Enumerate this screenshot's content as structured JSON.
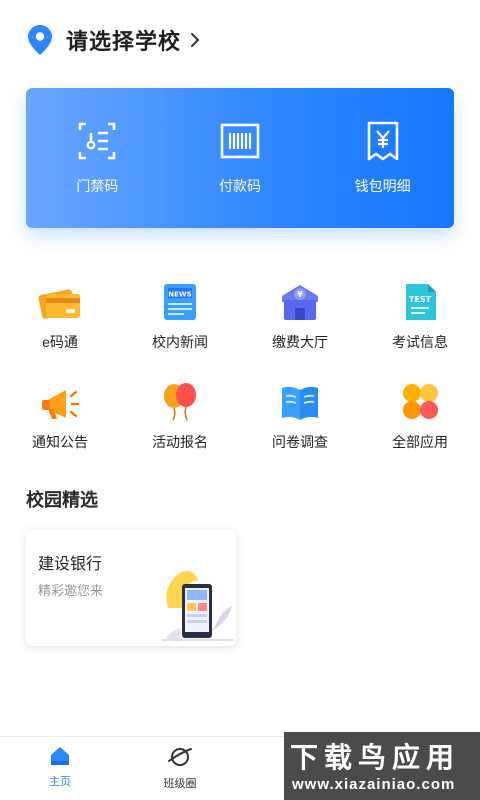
{
  "header": {
    "title": "请选择学校"
  },
  "card": {
    "items": [
      {
        "label": "门禁码",
        "icon": "access-card-icon"
      },
      {
        "label": "付款码",
        "icon": "barcode-icon"
      },
      {
        "label": "钱包明细",
        "icon": "yuan-receipt-icon"
      }
    ]
  },
  "grid": {
    "items": [
      {
        "label": "e码通",
        "icon": "card-wallet-icon"
      },
      {
        "label": "校内新闻",
        "icon": "news-icon"
      },
      {
        "label": "缴费大厅",
        "icon": "payment-hall-icon"
      },
      {
        "label": "考试信息",
        "icon": "test-doc-icon"
      },
      {
        "label": "通知公告",
        "icon": "megaphone-icon"
      },
      {
        "label": "活动报名",
        "icon": "balloons-icon"
      },
      {
        "label": "问卷调查",
        "icon": "open-book-icon"
      },
      {
        "label": "全部应用",
        "icon": "all-apps-icon"
      }
    ]
  },
  "section": {
    "title": "校园精选"
  },
  "promo": {
    "title": "建设银行",
    "subtitle": "精彩邀您来"
  },
  "bottom_nav": {
    "tabs": [
      {
        "label": "主页",
        "active": true
      },
      {
        "label": "班级圈",
        "active": false
      }
    ]
  },
  "watermark": {
    "title": "下载鸟应用",
    "url": "www.xiazainiao.com"
  },
  "colors": {
    "accent": "#2d86ff",
    "card_gradient_start": "#6aa6ff",
    "card_gradient_end": "#1677ff"
  }
}
